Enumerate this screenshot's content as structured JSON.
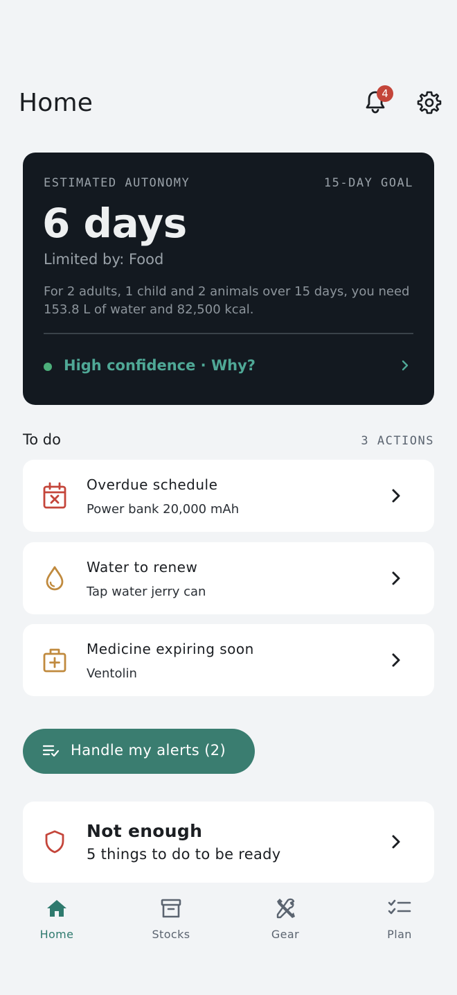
{
  "header": {
    "title": "Home",
    "notification_count": "4"
  },
  "autonomy": {
    "eyebrow": "ESTIMATED AUTONOMY",
    "goal": "15-DAY GOAL",
    "value": "6 days",
    "limited_by": "Limited by: Food",
    "description": "For 2 adults, 1 child and 2 animals over 15 days, you need 153.8 L of water and 82,500 kcal.",
    "confidence": "High confidence · Why?"
  },
  "todo": {
    "title": "To do",
    "count": "3 ACTIONS",
    "items": [
      {
        "title": "Overdue schedule",
        "subtitle": "Power bank 20,000 mAh",
        "icon": "calendar-x-icon"
      },
      {
        "title": "Water to renew",
        "subtitle": "Tap water jerry can",
        "icon": "water-drop-icon"
      },
      {
        "title": "Medicine expiring soon",
        "subtitle": "Ventolin",
        "icon": "medical-kit-icon"
      }
    ]
  },
  "alerts_button": {
    "label": "Handle my alerts (2)"
  },
  "readiness": {
    "title": "Not enough",
    "subtitle": "5 things to do to be ready"
  },
  "nav": {
    "items": [
      {
        "label": "Home",
        "icon": "home-icon"
      },
      {
        "label": "Stocks",
        "icon": "archive-box-icon"
      },
      {
        "label": "Gear",
        "icon": "tools-icon"
      },
      {
        "label": "Plan",
        "icon": "checklist-icon"
      }
    ]
  },
  "colors": {
    "background": "#f2f4f6",
    "card_dark": "#131920",
    "accent": "#3a7d70",
    "danger": "#c4453a",
    "warning": "#c08a3e"
  }
}
